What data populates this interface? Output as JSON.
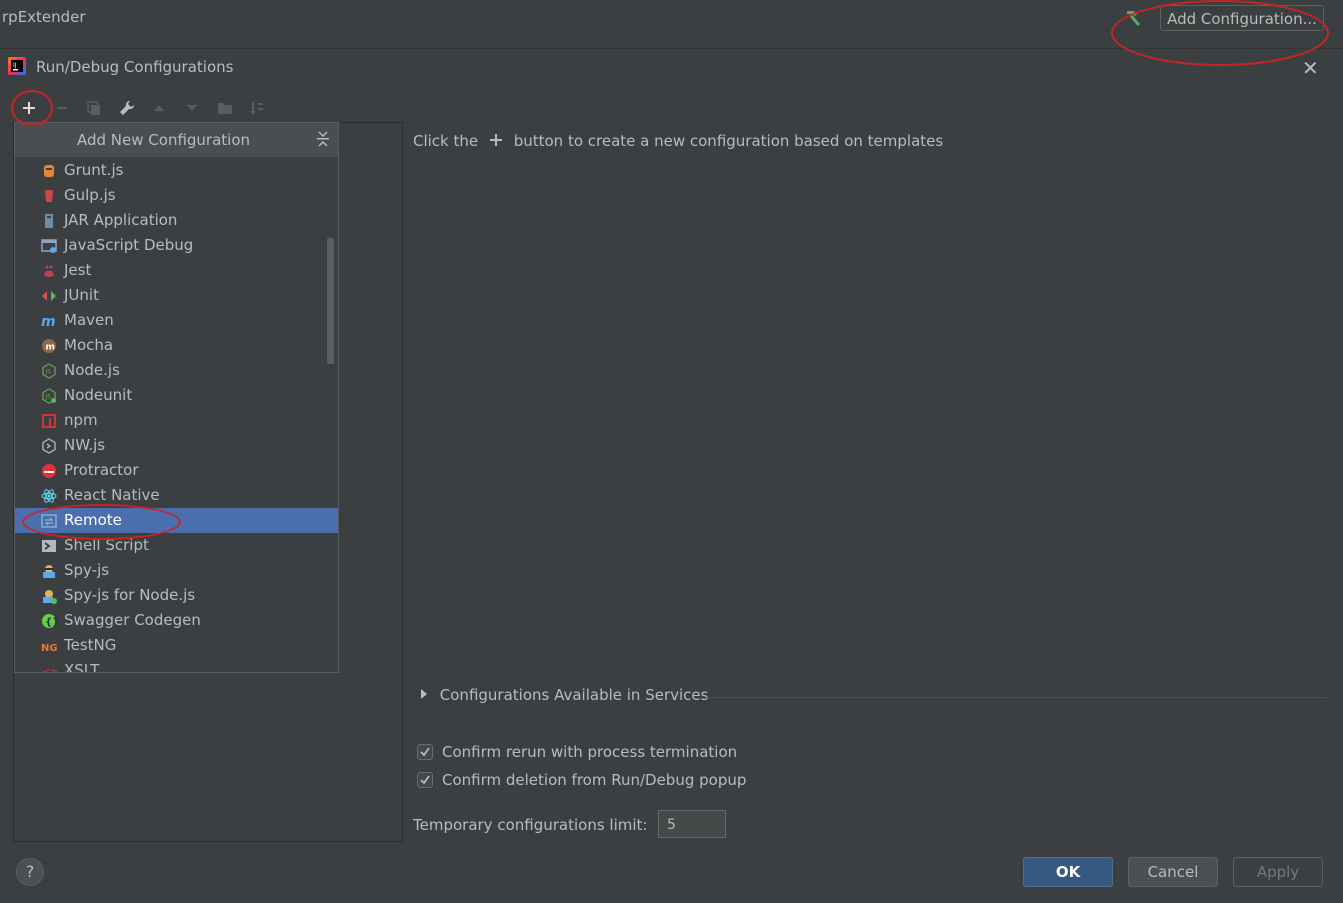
{
  "ide": {
    "project_title": "rpExtender",
    "add_config_label": "Add Configuration..."
  },
  "dialog": {
    "title": "Run/Debug Configurations",
    "popup_header": "Add New Configuration",
    "items": [
      {
        "label": "Grunt.js",
        "icon": "grunt-icon"
      },
      {
        "label": "Gulp.js",
        "icon": "gulp-icon"
      },
      {
        "label": "JAR Application",
        "icon": "jar-icon"
      },
      {
        "label": "JavaScript Debug",
        "icon": "js-debug-icon"
      },
      {
        "label": "Jest",
        "icon": "jest-icon"
      },
      {
        "label": "JUnit",
        "icon": "junit-icon"
      },
      {
        "label": "Maven",
        "icon": "maven-icon"
      },
      {
        "label": "Mocha",
        "icon": "mocha-icon"
      },
      {
        "label": "Node.js",
        "icon": "nodejs-icon"
      },
      {
        "label": "Nodeunit",
        "icon": "nodeunit-icon"
      },
      {
        "label": "npm",
        "icon": "npm-icon"
      },
      {
        "label": "NW.js",
        "icon": "nwjs-icon"
      },
      {
        "label": "Protractor",
        "icon": "protractor-icon"
      },
      {
        "label": "React Native",
        "icon": "react-icon"
      },
      {
        "label": "Remote",
        "icon": "remote-icon",
        "selected": true
      },
      {
        "label": "Shell Script",
        "icon": "shell-icon"
      },
      {
        "label": "Spy-js",
        "icon": "spyjs-icon"
      },
      {
        "label": "Spy-js for Node.js",
        "icon": "spyjs-node-icon"
      },
      {
        "label": "Swagger Codegen",
        "icon": "swagger-icon"
      },
      {
        "label": "TestNG",
        "icon": "testng-icon"
      },
      {
        "label": "XSLT",
        "icon": "xslt-icon"
      }
    ],
    "hint_prefix": "Click the",
    "hint_suffix": "button to create a new configuration based on templates",
    "services_label": "Configurations Available in Services",
    "confirm_rerun": "Confirm rerun with process termination",
    "confirm_deletion": "Confirm deletion from Run/Debug popup",
    "limit_label": "Temporary configurations limit:",
    "limit_value": "5",
    "ok_label": "OK",
    "cancel_label": "Cancel",
    "apply_label": "Apply",
    "help_label": "?"
  },
  "colors": {
    "selection": "#4b6eaf",
    "annotation": "#cc2222",
    "ok_button": "#365880"
  }
}
